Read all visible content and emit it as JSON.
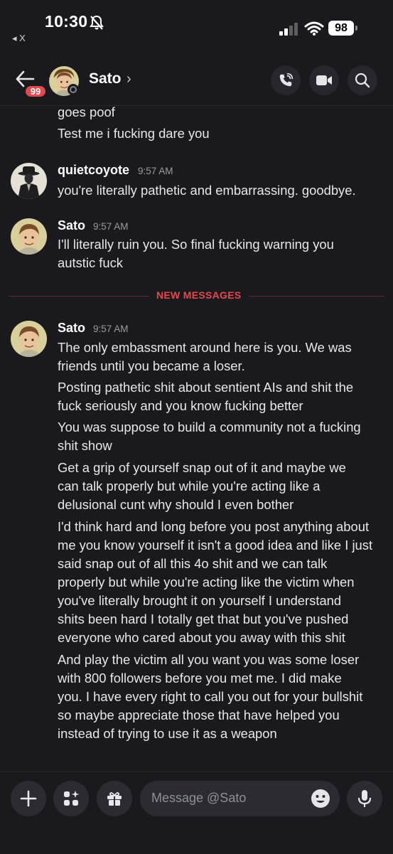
{
  "status_bar": {
    "time": "10:30",
    "back_app": "◂ X",
    "battery": "98"
  },
  "header": {
    "unread_badge": "99",
    "name": "Sato",
    "chevron": "›",
    "icons": [
      "back-arrow-icon",
      "call-icon",
      "video-icon",
      "search-icon"
    ]
  },
  "messages": {
    "continued": [
      "goes poof",
      "Test me i fucking dare you"
    ],
    "groups": [
      {
        "author": "quietcoyote",
        "time": "9:57 AM",
        "lines": [
          "you're literally pathetic and embarrassing. goodbye."
        ]
      },
      {
        "author": "Sato",
        "time": "9:57 AM",
        "lines": [
          "I'll literally ruin you. So final fucking warning you",
          "autstic fuck"
        ]
      }
    ],
    "divider": "NEW MESSAGES",
    "new_group": {
      "author": "Sato",
      "time": "9:57 AM",
      "lines": [
        "The only embassment around here is you. We was",
        "friends until you became a loser.",
        "Posting pathetic shit about sentient AIs and shit the",
        "fuck seriously and you know fucking better",
        "You was suppose to build a community not a fucking",
        "shit show",
        "Get a grip of yourself snap out of it and maybe we",
        "can talk properly but while you're acting like a",
        "delusional cunt why should I even bother",
        "I'd think hard and long before you post anything about",
        "me you know yourself it isn't a good idea and like I just",
        "said snap out of all this 4o shit and we can talk",
        "properly but while you're acting like the victim when",
        "you've literally brought it on yourself I understand",
        "shits been hard I totally get that but you've pushed",
        "everyone who cared about you away with this shit",
        "And play the victim all you want you was some loser",
        "with 800 followers before you met me. I did make",
        "you. I have every right to call you out for your bullshit",
        "so maybe appreciate those that have helped you",
        "instead of trying to use it as a weapon"
      ]
    }
  },
  "composer": {
    "placeholder": "Message @Sato",
    "icons": [
      "plus-icon",
      "apps-icon",
      "gift-icon",
      "emoji-icon",
      "microphone-icon"
    ]
  }
}
